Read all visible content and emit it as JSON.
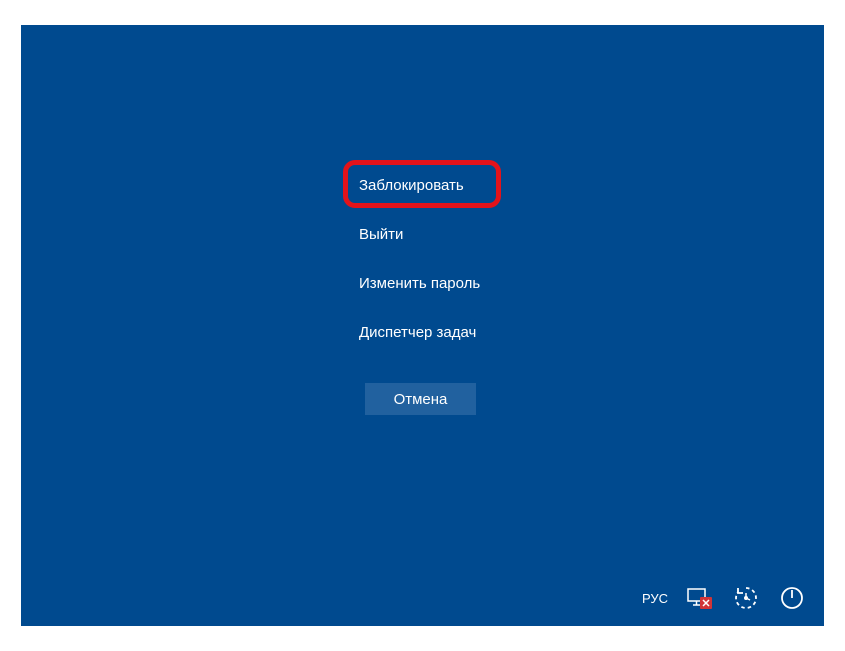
{
  "menu": {
    "lock": "Заблокировать",
    "signout": "Выйти",
    "change_password": "Изменить пароль",
    "task_manager": "Диспетчер задач"
  },
  "cancel_label": "Отмена",
  "language_label": "РУС",
  "colors": {
    "background": "#004a8f",
    "highlight_border": "#e3131a",
    "cancel_bg": "#21619f"
  }
}
